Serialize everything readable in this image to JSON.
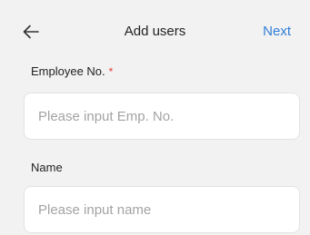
{
  "header": {
    "title": "Add users",
    "next_label": "Next",
    "back_icon": "arrow-left-icon"
  },
  "form": {
    "employee_no": {
      "label": "Employee No.",
      "required_mark": "*",
      "placeholder": "Please input Emp. No.",
      "value": ""
    },
    "name": {
      "label": "Name",
      "placeholder": "Please input name",
      "value": ""
    }
  },
  "colors": {
    "background": "#f2f2f2",
    "accent": "#2f7fd6",
    "required": "#e53935",
    "placeholder": "#a3a3a3"
  }
}
